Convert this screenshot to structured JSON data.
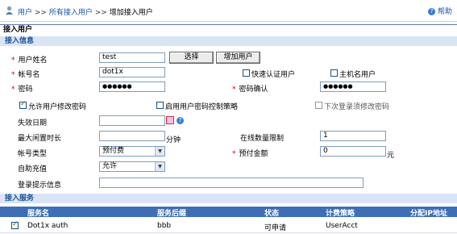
{
  "breadcrumb": {
    "item1": "用户",
    "item2": "所有接入用户",
    "current": "增加接入用户",
    "sep": ">>"
  },
  "help_label": "帮助",
  "page_title": "接入用户",
  "section_info": "接入信息",
  "form": {
    "username_label": "用户姓名",
    "username_value": "test",
    "select_button": "选择",
    "add_user_button": "增加用户",
    "account_label": "帐号名",
    "account_value": "dot1x",
    "fast_auth_label": "快速认证用户",
    "host_user_label": "主机名用户",
    "password_label": "密码",
    "password_value": "●●●●●●",
    "password_confirm_label": "密码确认",
    "password_confirm_value": "●●●●●●",
    "allow_change_pwd_label": "允许用户修改密码",
    "enable_pwd_policy_label": "启用用户密码控制策略",
    "force_change_label": "下次登录须修改密码",
    "expire_label": "失效日期",
    "expire_value": "",
    "idle_label": "最大闲置时长",
    "idle_value": "",
    "idle_unit": "分钟",
    "online_limit_label": "在线数量限制",
    "online_limit_value": "1",
    "acct_type_label": "帐号类型",
    "acct_type_value": "预付费",
    "prepay_label": "预付金额",
    "prepay_value": "0",
    "prepay_unit": "元",
    "auto_recharge_label": "自助充值",
    "auto_recharge_value": "允许",
    "login_msg_label": "登录提示信息",
    "login_msg_value": ""
  },
  "section_service": "接入服务",
  "service_table": {
    "headers": [
      "服务名",
      "服务后缀",
      "状态",
      "计费策略",
      "分配IP地址"
    ],
    "rows": [
      {
        "name": "Dot1x auth",
        "suffix": "bbb",
        "status": "可申请",
        "policy": "UserAcct",
        "ip": ""
      }
    ]
  },
  "colors": {
    "accent": "#3e6fb6",
    "section_bg": "#d9e5f4",
    "link": "#1a56b0"
  }
}
